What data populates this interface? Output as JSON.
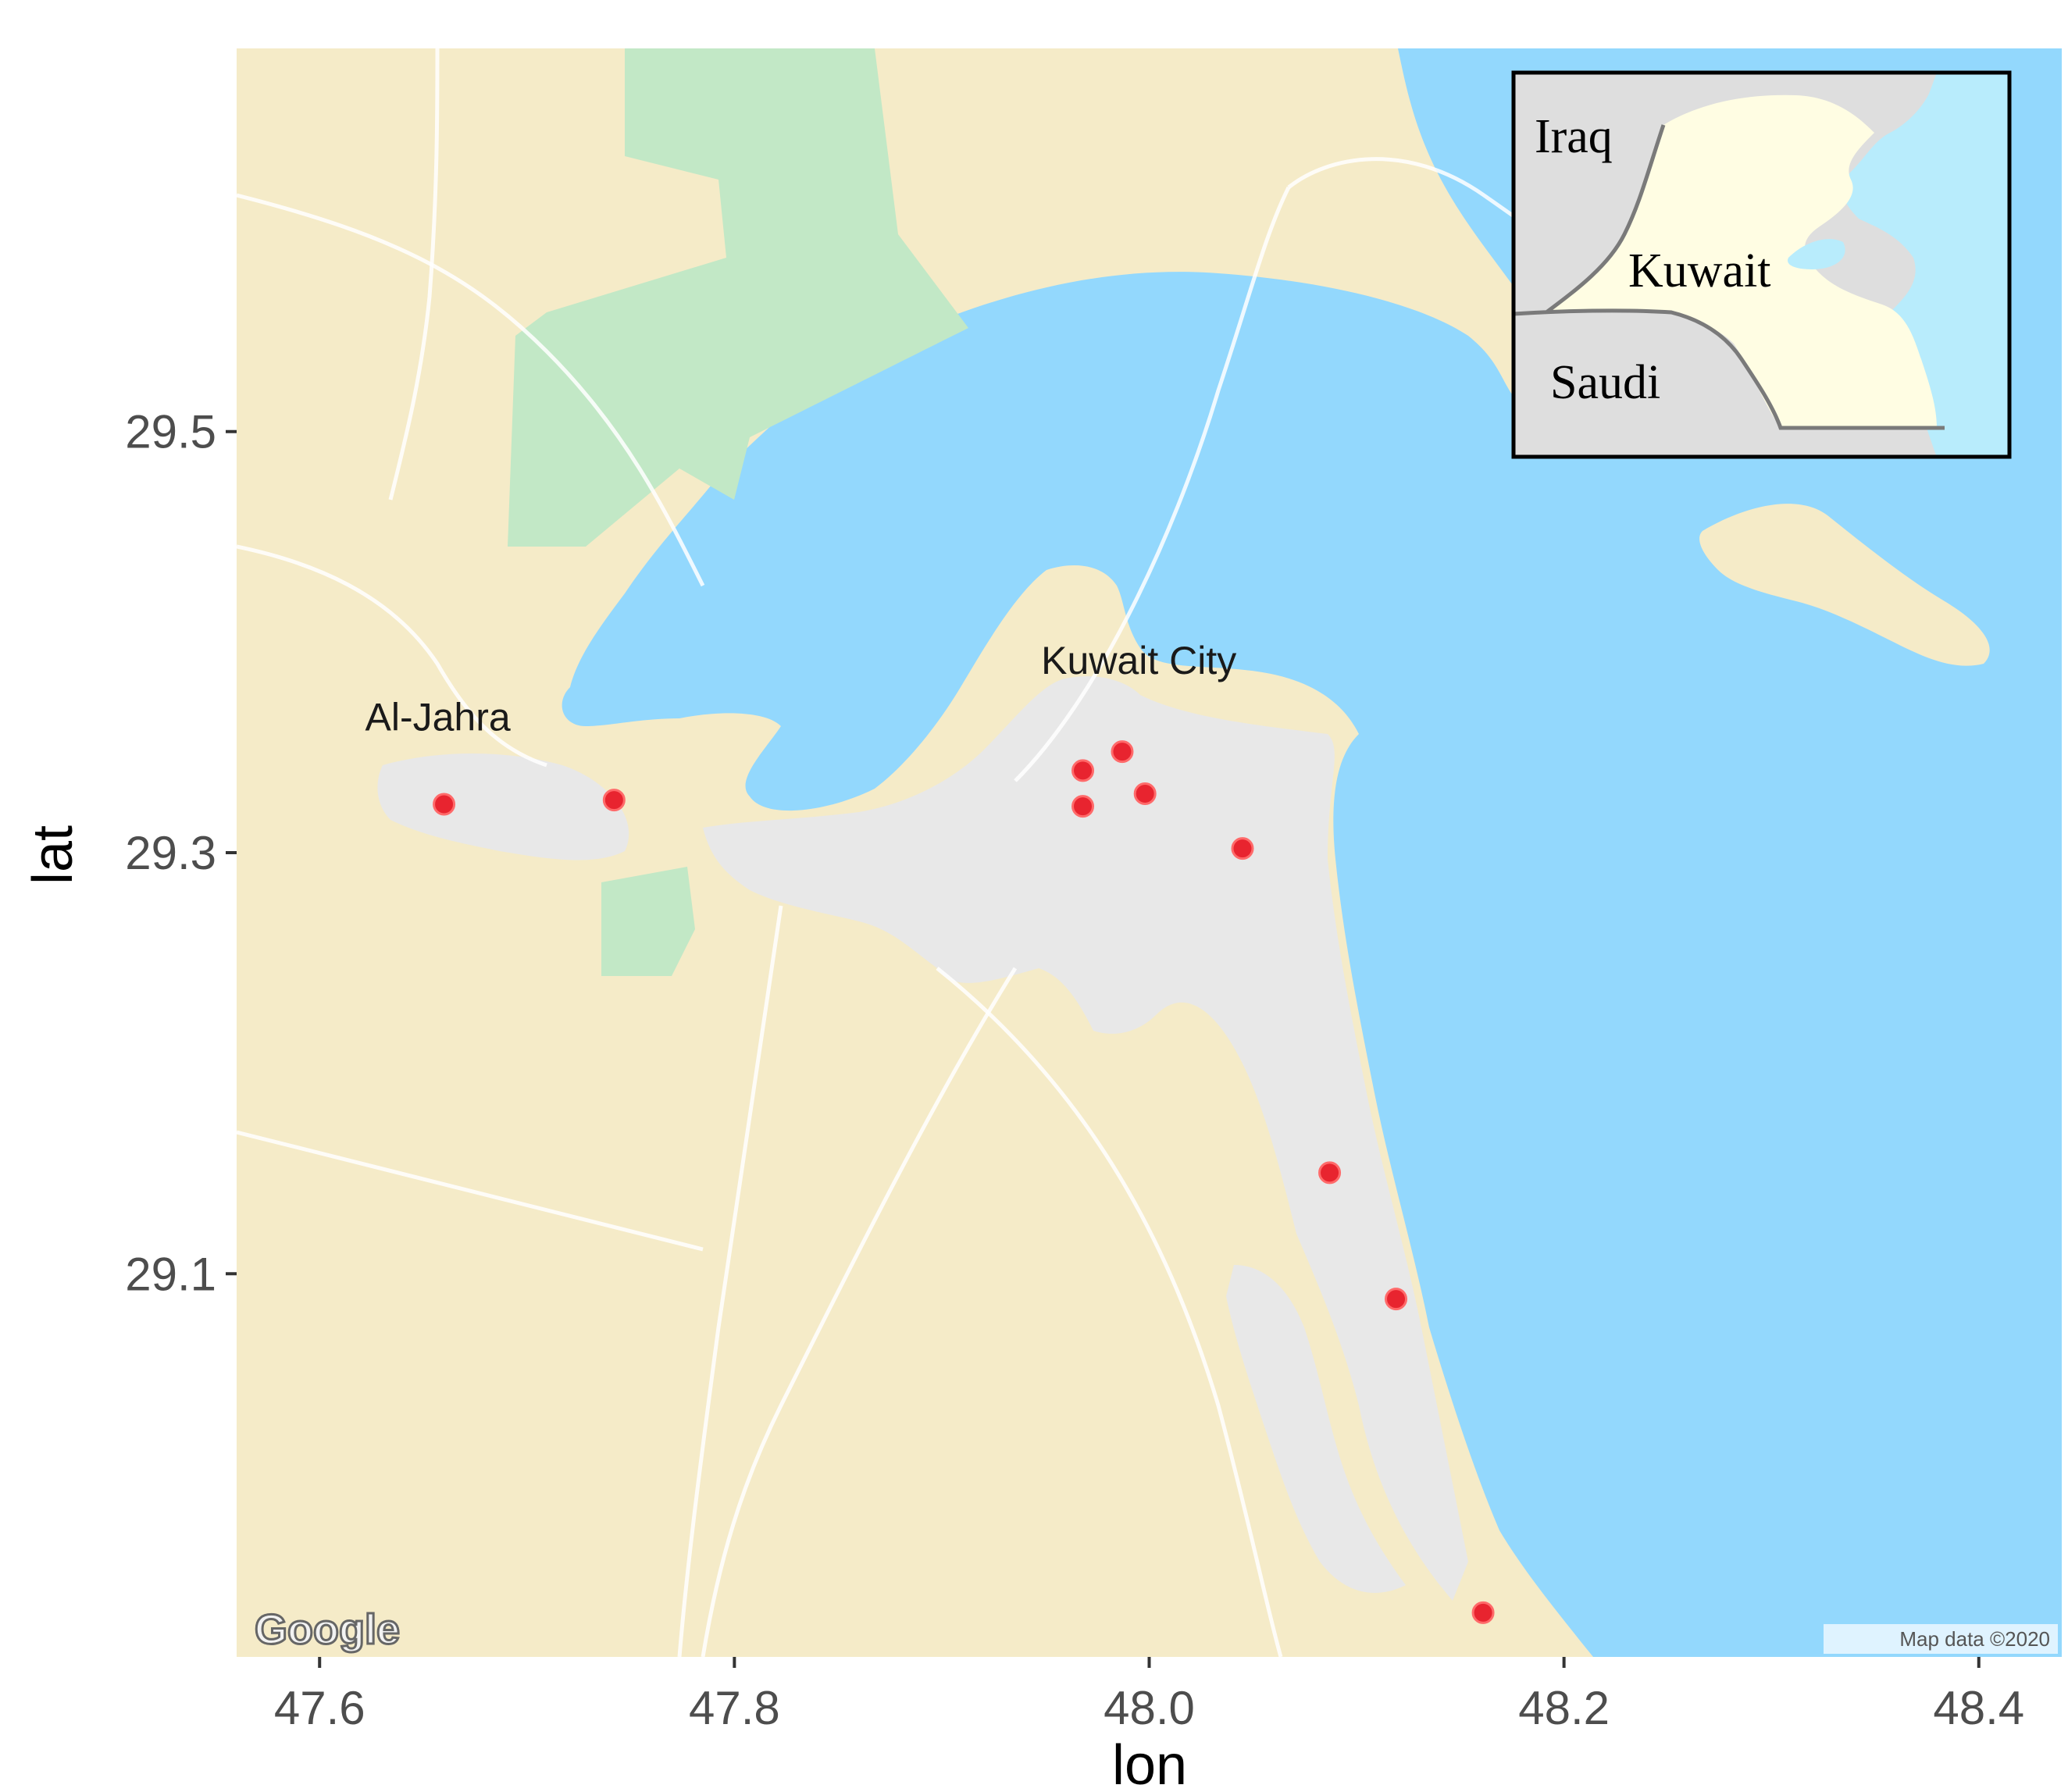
{
  "map": {
    "xlabel": "lon",
    "ylabel": "lat",
    "x_ticks": [
      47.6,
      47.8,
      48.0,
      48.2,
      48.4
    ],
    "y_ticks": [
      29.1,
      29.3,
      29.5
    ],
    "x_tick_labels": [
      "47.6",
      "47.8",
      "48.0",
      "48.2",
      "48.4"
    ],
    "y_tick_labels": [
      "29.1",
      "29.3",
      "29.5"
    ],
    "xlim": [
      47.56,
      48.44
    ],
    "ylim": [
      28.918,
      29.682
    ],
    "place_labels": [
      {
        "text": "Kuwait City",
        "lon": 47.995,
        "lat": 29.385
      },
      {
        "text": "Al-Jahra",
        "lon": 47.657,
        "lat": 29.358
      }
    ],
    "points": [
      {
        "lon": 47.66,
        "lat": 29.323
      },
      {
        "lon": 47.742,
        "lat": 29.325
      },
      {
        "lon": 47.987,
        "lat": 29.348
      },
      {
        "lon": 47.968,
        "lat": 29.339
      },
      {
        "lon": 47.968,
        "lat": 29.322
      },
      {
        "lon": 47.998,
        "lat": 29.328
      },
      {
        "lon": 48.045,
        "lat": 29.302
      },
      {
        "lon": 48.087,
        "lat": 29.148
      },
      {
        "lon": 48.119,
        "lat": 29.088
      },
      {
        "lon": 48.161,
        "lat": 28.939
      }
    ],
    "point_color": "#e8242f",
    "water_color": "#93d8fd",
    "land_color": "#f5ebc8",
    "urban_color": "#e8e8e8",
    "park_color": "#c2e8c6",
    "attribution": "Map data ©2020",
    "logo_text": "Google"
  },
  "inset": {
    "labels": {
      "iraq": "Iraq",
      "kuwait": "Kuwait",
      "saudi": "Saudi"
    },
    "kuwait_fill": "#fffde3",
    "neighbor_fill": "#dedede",
    "water_fill": "#b8ecfc"
  }
}
